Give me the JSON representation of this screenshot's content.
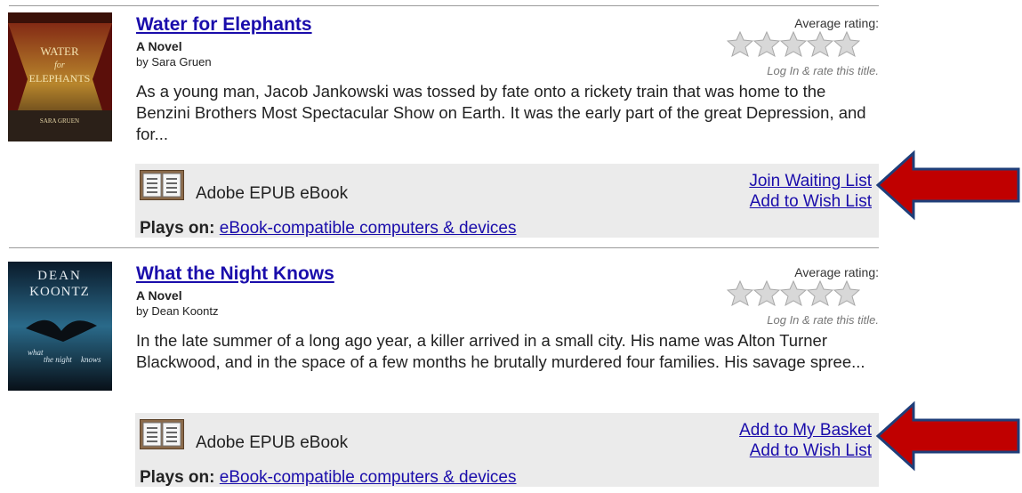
{
  "rating_label": "Average rating:",
  "rate_prompt": "Log In & rate this title.",
  "books": [
    {
      "title": "Water for Elephants",
      "subtitle": "A Novel",
      "byline": "by Sara Gruen",
      "description": "As a young man, Jacob Jankowski was tossed by fate onto a rickety train that was home to the Benzini Brothers Most Spectacular Show on Earth. It was the early part of the great Depression, and for...",
      "format": "Adobe EPUB eBook",
      "actions": [
        "Join Waiting List",
        "Add to Wish List"
      ],
      "plays_on_label": "Plays on:",
      "plays_on_link": "eBook-compatible computers & devices"
    },
    {
      "title": "What the Night Knows",
      "subtitle": "A Novel",
      "byline": "by Dean Koontz",
      "description": "In the late summer of a long ago year, a killer arrived in a small city. His name was Alton Turner Blackwood, and in the space of a few months he brutally murdered four families. His savage spree...",
      "format": "Adobe EPUB eBook",
      "actions": [
        "Add to My Basket",
        "Add to Wish List"
      ],
      "plays_on_label": "Plays on:",
      "plays_on_link": "eBook-compatible computers & devices"
    }
  ],
  "covers": [
    {
      "text_lines": [
        "WATER",
        "for",
        "ELEPHANTS"
      ],
      "author": "SARA GRUEN"
    },
    {
      "author_lines": [
        "DEAN",
        "KOONTZ"
      ],
      "text_lines": [
        "what",
        "the night",
        "knows"
      ]
    }
  ],
  "colors": {
    "link": "#1a0dab",
    "format_box": "#ebebeb",
    "arrow_fill": "#c00000",
    "arrow_stroke": "#1f3f7a",
    "star": "#d0d0d0"
  },
  "icons": {
    "book": "open-book-icon",
    "stars": "star-rating-icon",
    "arrow": "left-arrow-icon"
  }
}
